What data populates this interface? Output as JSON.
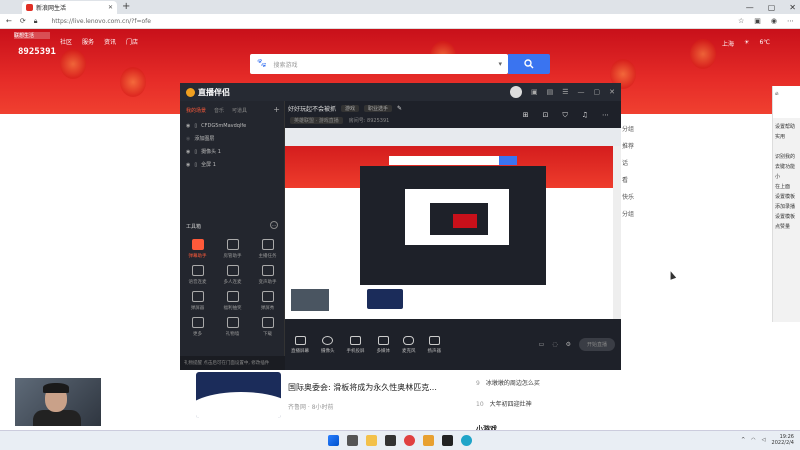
{
  "browser": {
    "tab_title": "新浪网生活",
    "url": "https://live.lenovo.com.cn/?f=ofe",
    "window_min": "—",
    "window_max": "▢",
    "window_close": "✕"
  },
  "page": {
    "logo_text": "联想生活",
    "top_nav": [
      "社区",
      "服务",
      "资讯",
      "门店"
    ],
    "big_id": "8925391",
    "weather": {
      "city": "上海",
      "temp": "6℃"
    },
    "search_placeholder": "搜索游戏",
    "news": {
      "title": "国际奥委会: 滑板将成为永久性奥林匹克...",
      "source": "齐鲁网 · 8小时前"
    },
    "hot_list": [
      {
        "n": "9",
        "text": "冰墩墩的周边怎么买"
      },
      {
        "n": "10",
        "text": "大年初四迎灶神"
      }
    ],
    "more_label": "小游戏",
    "right_snippets": [
      "分组",
      "推荐",
      "话",
      "看",
      "快乐",
      "分组"
    ]
  },
  "side_panel": {
    "items": [
      "设置帮助",
      "实用",
      "识别我的",
      "去键功能",
      "小",
      "在上面",
      "设置模板",
      "添加录播",
      "设置模板",
      "点赞量"
    ]
  },
  "app": {
    "name": "直播伴侣",
    "left_tabs": [
      "我的场景",
      "音乐",
      "可道具"
    ],
    "layers": [
      "CFDG5mMavdqlfe",
      "添加图层",
      "摄像头 1",
      "全屏 1"
    ],
    "tools_heading": "工具箱",
    "tools": [
      {
        "label": "弹幕助手",
        "active": true
      },
      {
        "label": "房管助手",
        "active": false
      },
      {
        "label": "主播任务",
        "active": false
      },
      {
        "label": "语音连麦",
        "active": false
      },
      {
        "label": "多人连麦",
        "active": false
      },
      {
        "label": "变声助手",
        "active": false
      },
      {
        "label": "弹屏器",
        "active": false
      },
      {
        "label": "福利抽奖",
        "active": false
      },
      {
        "label": "弹屏秀",
        "active": false
      },
      {
        "label": "更多",
        "active": false
      },
      {
        "label": "礼物墙",
        "active": false
      },
      {
        "label": "下载",
        "active": false
      }
    ],
    "status_text": "礼物提醒  点击后可在门面设置中, 修改插件",
    "room_title": "好好玩起不会被抓",
    "room_tag": "游戏",
    "room_category": "职业选手",
    "room_sub": [
      "英雄联盟 · 游戏直播",
      "房间号: 8925391"
    ],
    "bottom_tools": [
      "直播屏幕",
      "摄像头",
      "手机投屏",
      "多媒体",
      "麦克风",
      "扬声器"
    ],
    "go_live": "开始直播"
  },
  "taskbar": {
    "time": "19:26",
    "date": "2022/2/4"
  },
  "colors": {
    "brand_red": "#e62c28",
    "search_blue": "#3a74f0",
    "app_accent": "#ff5a3a"
  }
}
